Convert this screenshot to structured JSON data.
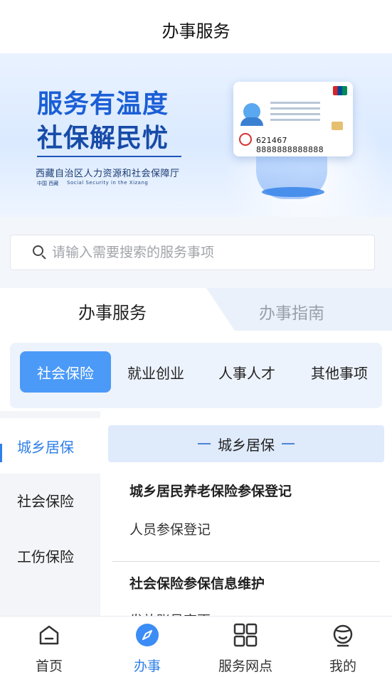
{
  "header": {
    "title": "办事服务"
  },
  "banner": {
    "slogan_line1": "服务有温度",
    "slogan_line2": "社保解民忧",
    "department": "西藏自治区人力资源和社会保障厅",
    "tag_prefix": "中国  西藏",
    "tag_en": "Social Security in the Xizang",
    "card_number": "621467 8888888888888"
  },
  "search": {
    "placeholder": "请输入需要搜索的服务事项"
  },
  "tabs": {
    "active": "办事服务",
    "inactive": "办事指南"
  },
  "categories": [
    {
      "label": "社会保险",
      "active": true
    },
    {
      "label": "就业创业",
      "active": false
    },
    {
      "label": "人事人才",
      "active": false
    },
    {
      "label": "其他事项",
      "active": false
    }
  ],
  "left_nav": [
    {
      "label": "城乡居保",
      "active": true
    },
    {
      "label": "社会保险",
      "active": false
    },
    {
      "label": "工伤保险",
      "active": false
    }
  ],
  "content": {
    "section_title": "城乡居保",
    "groups": [
      {
        "title": "城乡居民养老保险参保登记",
        "items": [
          "人员参保登记"
        ]
      },
      {
        "title": "社会保险参保信息维护",
        "items": [
          "发放账号变更"
        ]
      }
    ]
  },
  "bottom_nav": [
    {
      "label": "首页",
      "icon": "home-icon",
      "active": false
    },
    {
      "label": "办事",
      "icon": "compass-icon",
      "active": true
    },
    {
      "label": "服务网点",
      "icon": "grid-icon",
      "active": false
    },
    {
      "label": "我的",
      "icon": "profile-icon",
      "active": false
    }
  ],
  "colors": {
    "accent": "#4b9af7",
    "accent_text": "#2f7fe8",
    "banner_blue": "#1b5fd6"
  }
}
